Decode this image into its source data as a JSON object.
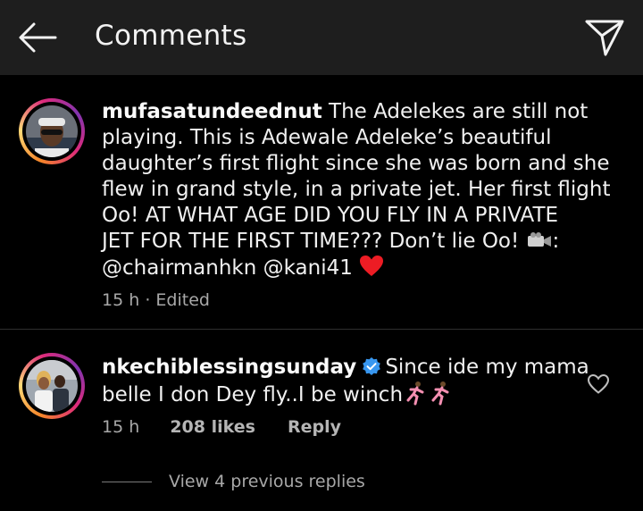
{
  "header": {
    "title": "Comments",
    "back_icon": "arrow-left-icon",
    "share_icon": "paper-plane-icon"
  },
  "comments": [
    {
      "username": "mufasatundeednut",
      "lines": [
        " The Adelekes are still not",
        "playing. This is Adewale Adeleke’s beautiful",
        "daughter’s first flight since she was born and she",
        "flew in grand style, in a private jet. Her first flight",
        "Oo! AT WHAT AGE DID YOU FLY IN A PRIVATE",
        "JET FOR THE FIRST TIME??? Don’t lie Oo! ",
        ":",
        "@chairmanhkn @kani41 "
      ],
      "time": "15 h",
      "separator": "·",
      "edited": "Edited",
      "emoji": [
        "video-camera-emoji",
        "red-heart-emoji"
      ]
    },
    {
      "username": "nkechiblessingsunday",
      "verified": true,
      "lines": [
        "Since ide my mama",
        "belle I don Dey fly..I be winch"
      ],
      "time": "15 h",
      "likes": "208 likes",
      "reply_label": "Reply",
      "emoji": [
        "woman-running-emoji",
        "woman-running-emoji"
      ]
    }
  ],
  "view_replies": "View 4 previous replies",
  "colors": {
    "background": "#000000",
    "header": "#1e1e1e",
    "text": "#f0f0f0",
    "meta": "#a8a8a8",
    "verified": "#3897f0",
    "heart": "#ed1c24"
  }
}
